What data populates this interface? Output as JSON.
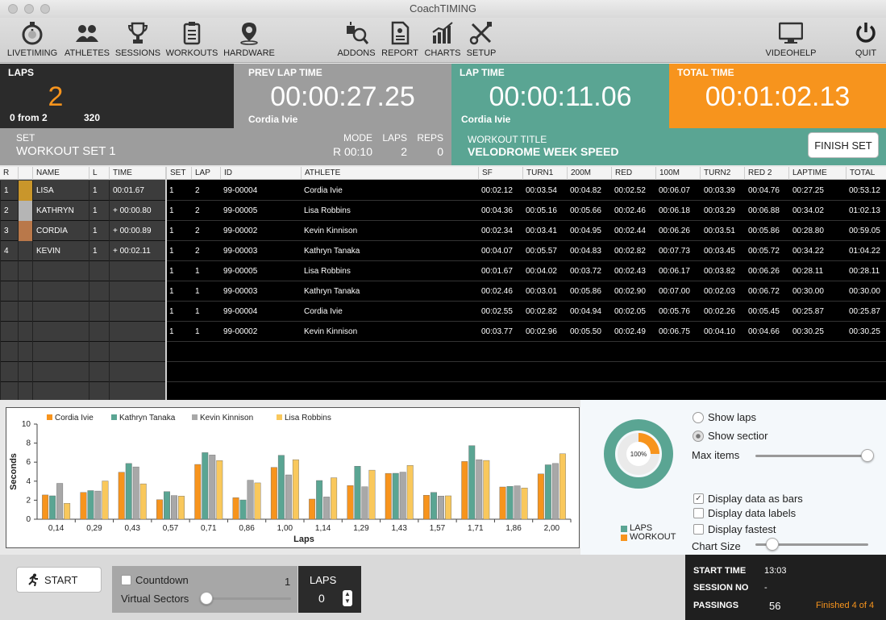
{
  "app": {
    "title": "CoachTIMING"
  },
  "toolbar": [
    {
      "name": "livetiming",
      "label": "LIVETIMING",
      "icon": "stopwatch-icon"
    },
    {
      "name": "athletes",
      "label": "ATHLETES",
      "icon": "athletes-icon"
    },
    {
      "name": "sessions",
      "label": "SESSIONS",
      "icon": "trophy-icon"
    },
    {
      "name": "workouts",
      "label": "WORKOUTS",
      "icon": "clipboard-icon"
    },
    {
      "name": "hardware",
      "label": "HARDWARE",
      "icon": "location-pin-icon"
    },
    {
      "name": "addons",
      "label": "ADDONS",
      "icon": "addons-icon"
    },
    {
      "name": "report",
      "label": "REPORT",
      "icon": "report-icon"
    },
    {
      "name": "charts",
      "label": "CHARTS",
      "icon": "bar-chart-icon"
    },
    {
      "name": "setup",
      "label": "SETUP",
      "icon": "tools-icon"
    },
    {
      "name": "videohelp",
      "label": "VIDEOHELP",
      "icon": "monitor-icon"
    },
    {
      "name": "quit",
      "label": "QUIT",
      "icon": "power-icon"
    }
  ],
  "laps_panel": {
    "label": "LAPS",
    "value": "2",
    "progress": "0 from 2",
    "distance": "320"
  },
  "prev_lap": {
    "label": "PREV LAP TIME",
    "value": "00:00:27.25",
    "athlete": "Cordia Ivie"
  },
  "lap_time": {
    "label": "LAP TIME",
    "value": "00:00:11.06",
    "athlete": "Cordia Ivie"
  },
  "total_time": {
    "label": "TOTAL TIME",
    "value": "00:01:02.13"
  },
  "set_bar": {
    "set_label": "SET",
    "set_value": "WORKOUT SET 1",
    "mode_label": "MODE",
    "mode_value": "R 00:10",
    "laps_label": "LAPS",
    "laps_value": "2",
    "reps_label": "REPS",
    "reps_value": "0"
  },
  "workout_bar": {
    "title_label": "WORKOUT TITLE",
    "title_value": "VELODROME WEEK SPEED",
    "finish_label": "FINISH SET"
  },
  "ranking": {
    "headers": [
      "R",
      "",
      "NAME",
      "L",
      "TIME"
    ],
    "rows": [
      {
        "r": "1",
        "color": "#c9962b",
        "name": "LISA",
        "l": "1",
        "time": "00:01.67"
      },
      {
        "r": "2",
        "color": "#b5b5b5",
        "name": "KATHRYN",
        "l": "1",
        "time": "+ 00:00.80"
      },
      {
        "r": "3",
        "color": "#b9784a",
        "name": "CORDIA",
        "l": "1",
        "time": "+ 00:00.89"
      },
      {
        "r": "4",
        "color": "",
        "name": "KEVIN",
        "l": "1",
        "time": "+ 00:02.11"
      }
    ]
  },
  "passings": {
    "headers": [
      "SET",
      "LAP",
      "ID",
      "ATHLETE",
      "SF",
      "TURN1",
      "200M",
      "RED",
      "100M",
      "TURN2",
      "RED 2",
      "LAPTIME",
      "TOTAL"
    ],
    "rows": [
      [
        "1",
        "2",
        "99-00004",
        "Cordia Ivie",
        "00:02.12",
        "00:03.54",
        "00:04.82",
        "00:02.52",
        "00:06.07",
        "00:03.39",
        "00:04.76",
        "00:27.25",
        "00:53.12"
      ],
      [
        "1",
        "2",
        "99-00005",
        "Lisa Robbins",
        "00:04.36",
        "00:05.16",
        "00:05.66",
        "00:02.46",
        "00:06.18",
        "00:03.29",
        "00:06.88",
        "00:34.02",
        "01:02.13"
      ],
      [
        "1",
        "2",
        "99-00002",
        "Kevin  Kinnison",
        "00:02.34",
        "00:03.41",
        "00:04.95",
        "00:02.44",
        "00:06.26",
        "00:03.51",
        "00:05.86",
        "00:28.80",
        "00:59.05"
      ],
      [
        "1",
        "2",
        "99-00003",
        "Kathryn Tanaka",
        "00:04.07",
        "00:05.57",
        "00:04.83",
        "00:02.82",
        "00:07.73",
        "00:03.45",
        "00:05.72",
        "00:34.22",
        "01:04.22"
      ],
      [
        "1",
        "1",
        "99-00005",
        "Lisa Robbins",
        "00:01.67",
        "00:04.02",
        "00:03.72",
        "00:02.43",
        "00:06.17",
        "00:03.82",
        "00:06.26",
        "00:28.11",
        "00:28.11"
      ],
      [
        "1",
        "1",
        "99-00003",
        "Kathryn Tanaka",
        "00:02.46",
        "00:03.01",
        "00:05.86",
        "00:02.90",
        "00:07.00",
        "00:02.03",
        "00:06.72",
        "00:30.00",
        "00:30.00"
      ],
      [
        "1",
        "1",
        "99-00004",
        "Cordia Ivie",
        "00:02.55",
        "00:02.82",
        "00:04.94",
        "00:02.05",
        "00:05.76",
        "00:02.26",
        "00:05.45",
        "00:25.87",
        "00:25.87"
      ],
      [
        "1",
        "1",
        "99-00002",
        "Kevin  Kinnison",
        "00:03.77",
        "00:02.96",
        "00:05.50",
        "00:02.49",
        "00:06.75",
        "00:04.10",
        "00:04.66",
        "00:30.25",
        "00:30.25"
      ]
    ]
  },
  "chart_data": {
    "type": "bar",
    "title": "",
    "xlabel": "Laps",
    "ylabel": "Seconds",
    "ylim": [
      0,
      10
    ],
    "yticks": [
      "0",
      "2",
      "4",
      "6",
      "8",
      "10"
    ],
    "grid": false,
    "legend": "top-left",
    "categories": [
      "0,14",
      "0,29",
      "0,43",
      "0,57",
      "0,71",
      "0,86",
      "1,00",
      "1,14",
      "1,29",
      "1,43",
      "1,57",
      "1,71",
      "1,86",
      "2,00"
    ],
    "series": [
      {
        "name": "Cordia Ivie",
        "color": "#f7941d",
        "values": [
          2.55,
          2.82,
          4.94,
          2.05,
          5.76,
          2.26,
          5.45,
          2.12,
          3.54,
          4.82,
          2.52,
          6.07,
          3.39,
          4.76
        ]
      },
      {
        "name": "Kathryn Tanaka",
        "color": "#5aa593",
        "values": [
          2.46,
          3.01,
          5.86,
          2.9,
          7.0,
          2.03,
          6.72,
          4.07,
          5.57,
          4.83,
          2.82,
          7.73,
          3.45,
          5.72
        ]
      },
      {
        "name": "Kevin  Kinnison",
        "color": "#a8a8a8",
        "values": [
          3.77,
          2.96,
          5.5,
          2.49,
          6.75,
          4.1,
          4.66,
          2.34,
          3.41,
          4.95,
          2.44,
          6.26,
          3.51,
          5.86
        ]
      },
      {
        "name": "Lisa Robbins",
        "color": "#f9c85c",
        "values": [
          1.67,
          4.02,
          3.72,
          2.43,
          6.17,
          3.82,
          6.26,
          4.36,
          5.16,
          5.66,
          2.46,
          6.18,
          3.29,
          6.88
        ]
      }
    ]
  },
  "donut": {
    "center_label": "100%",
    "progress": 1.0,
    "legend": [
      {
        "label": "LAPS",
        "color": "#5aa593"
      },
      {
        "label": "WORKOUT",
        "color": "#f7941d"
      }
    ]
  },
  "options": {
    "show_laps": "Show laps",
    "show_sectors": "Show sectior",
    "max_items": "Max items",
    "display_bars": "Display data as bars",
    "display_labels": "Display data labels",
    "display_fastest": "Display fastest",
    "chart_size": "Chart Size"
  },
  "bottom": {
    "start_label": "START",
    "countdown_label": "Countdown",
    "countdown_value": "1",
    "virtual_sectors": "Virtual Sectors",
    "laps_label": "LAPS",
    "laps_value": "0",
    "start_time_label": "START TIME",
    "start_time_value": "13:03",
    "session_no_label": "SESSION NO",
    "session_no_value": "-",
    "passings_label": "PASSINGS",
    "passings_value": "56",
    "finished": "Finished 4 of 4"
  }
}
